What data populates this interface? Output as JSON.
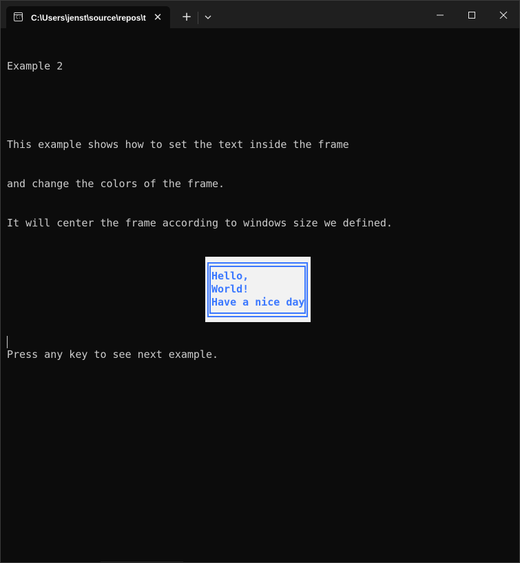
{
  "window": {
    "tab_title": "C:\\Users\\jenst\\source\\repos\\t",
    "tab_icon_text": "C:\\",
    "close_tab_symbol": "✕",
    "new_tab_symbol": "+"
  },
  "terminal": {
    "lines": [
      "Example 2",
      "",
      "This example shows how to set the text inside the frame",
      "and change the colors of the frame.",
      "It will center the frame according to windows size we defined."
    ],
    "prompt": "Press any key to see next example."
  },
  "frame": {
    "lines": [
      "Hello,",
      "World!",
      "Have a nice day"
    ],
    "colors": {
      "background": "#f2f2f2",
      "border": "#3b78ff",
      "text": "#3b78ff"
    }
  },
  "colors": {
    "terminal_bg": "#0c0c0c",
    "terminal_fg": "#cccccc",
    "titlebar_bg": "#1f1f1f"
  }
}
